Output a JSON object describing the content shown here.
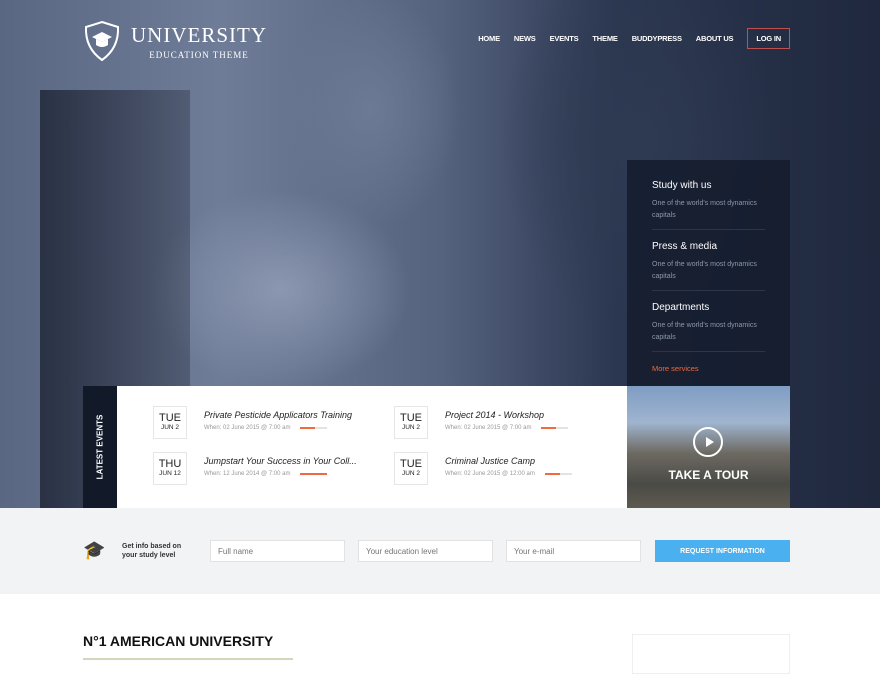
{
  "logo": {
    "title": "UNIVERSITY",
    "subtitle": "EDUCATION THEME"
  },
  "nav": [
    "HOME",
    "NEWS",
    "EVENTS",
    "THEME",
    "BUDDYPRESS",
    "ABOUT US"
  ],
  "login": "LOG IN",
  "services": [
    {
      "title": "Study with us",
      "text": "One of the world's most dynamics capitals"
    },
    {
      "title": "Press & media",
      "text": "One of the world's most dynamics capitals"
    },
    {
      "title": "Departments",
      "text": "One of the world's most dynamics capitals"
    }
  ],
  "more_services": "More services",
  "events_label": "LATEST EVENTS",
  "events": [
    {
      "day": "TUE",
      "date": "JUN 2",
      "title": "Private Pesticide Applicators Training",
      "when": "When: 02 June 2015 @ 7:00 am",
      "progress": 0.55
    },
    {
      "day": "TUE",
      "date": "JUN 2",
      "title": "Project 2014 - Workshop",
      "when": "When: 02 June 2015 @ 7:00 am",
      "progress": 0.55
    },
    {
      "day": "THU",
      "date": "JUN 12",
      "title": "Jumpstart Your Success in Your Coll...",
      "when": "When: 12 June 2014 @ 7:00 am",
      "progress": 1.0
    },
    {
      "day": "TUE",
      "date": "JUN 2",
      "title": "Criminal Justice Camp",
      "when": "When: 02 June 2015 @ 12:00 am",
      "progress": 0.55
    }
  ],
  "tour": "TAKE A TOUR",
  "request": {
    "text1": "Get info based on",
    "text2": "your study level",
    "name_ph": "Full name",
    "edu_ph": "Your education level",
    "email_ph": "Your e-mail",
    "button": "REQUEST INFORMATION"
  },
  "heading": "N°1 AMERICAN UNIVERSITY"
}
